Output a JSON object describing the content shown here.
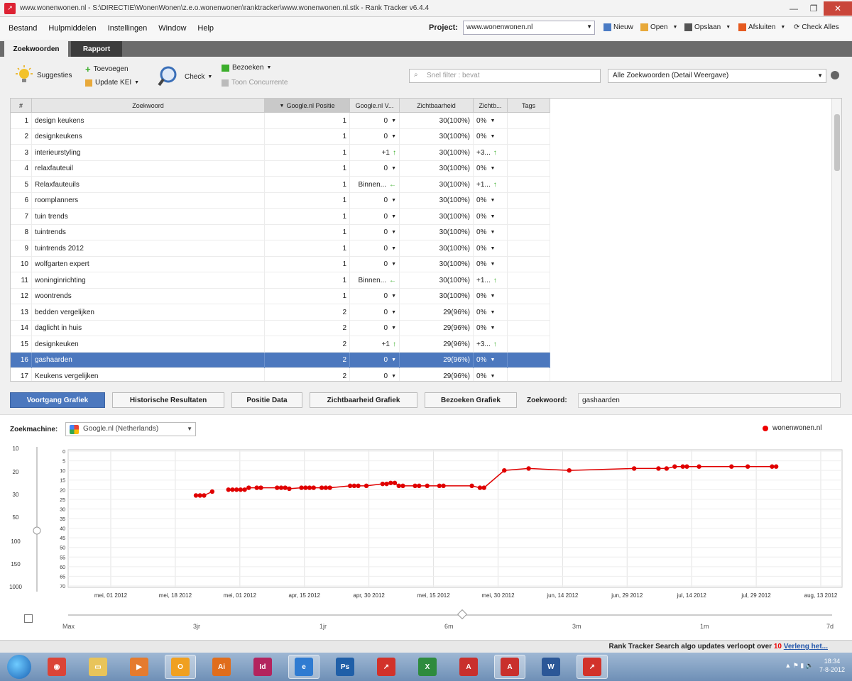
{
  "window": {
    "title": "www.wonenwonen.nl - S:\\DIRECTIE\\WonenWonen\\z.e.o.wonenwonen\\ranktracker\\www.wonenwonen.nl.stk - Rank Tracker v6.4.4"
  },
  "menu": [
    "Bestand",
    "Hulpmiddelen",
    "Instellingen",
    "Window",
    "Help"
  ],
  "project": {
    "label": "Project:",
    "value": "www.wonenwonen.nl"
  },
  "top_actions": {
    "new": "Nieuw",
    "open": "Open",
    "save": "Opslaan",
    "close": "Afsluiten",
    "check_all": "Check Alles"
  },
  "tabs": {
    "keywords": "Zoekwoorden",
    "report": "Rapport"
  },
  "toolbar": {
    "suggestions": "Suggesties",
    "add": "Toevoegen",
    "update_kei": "Update KEI",
    "check": "Check",
    "visits": "Bezoeken",
    "show_competitors": "Toon Concurrente",
    "filter_placeholder": "Snel filter : bevat",
    "view": "Alle Zoekwoorden (Detail Weergave)"
  },
  "grid": {
    "headers": [
      "#",
      "Zoekwoord",
      "Google.nl Positie",
      "Google.nl V...",
      "Zichtbaarheid",
      "Zichtb...",
      "Tags"
    ],
    "rows": [
      {
        "n": "1",
        "kw": "design keukens",
        "pos": "1",
        "ch": "0",
        "chi": "dd",
        "vis": "30(100%)",
        "vc": "0%",
        "vci": "dd"
      },
      {
        "n": "2",
        "kw": "designkeukens",
        "pos": "1",
        "ch": "0",
        "chi": "dd",
        "vis": "30(100%)",
        "vc": "0%",
        "vci": "dd"
      },
      {
        "n": "3",
        "kw": "interieurstyling",
        "pos": "1",
        "ch": "+1",
        "chi": "up",
        "vis": "30(100%)",
        "vc": "+3...",
        "vci": "up"
      },
      {
        "n": "4",
        "kw": "relaxfauteuil",
        "pos": "1",
        "ch": "0",
        "chi": "dd",
        "vis": "30(100%)",
        "vc": "0%",
        "vci": "dd"
      },
      {
        "n": "5",
        "kw": "Relaxfauteuils",
        "pos": "1",
        "ch": "Binnen...",
        "chi": "left",
        "vis": "30(100%)",
        "vc": "+1...",
        "vci": "up"
      },
      {
        "n": "6",
        "kw": "roomplanners",
        "pos": "1",
        "ch": "0",
        "chi": "dd",
        "vis": "30(100%)",
        "vc": "0%",
        "vci": "dd"
      },
      {
        "n": "7",
        "kw": "tuin trends",
        "pos": "1",
        "ch": "0",
        "chi": "dd",
        "vis": "30(100%)",
        "vc": "0%",
        "vci": "dd"
      },
      {
        "n": "8",
        "kw": "tuintrends",
        "pos": "1",
        "ch": "0",
        "chi": "dd",
        "vis": "30(100%)",
        "vc": "0%",
        "vci": "dd"
      },
      {
        "n": "9",
        "kw": "tuintrends 2012",
        "pos": "1",
        "ch": "0",
        "chi": "dd",
        "vis": "30(100%)",
        "vc": "0%",
        "vci": "dd"
      },
      {
        "n": "10",
        "kw": "wolfgarten expert",
        "pos": "1",
        "ch": "0",
        "chi": "dd",
        "vis": "30(100%)",
        "vc": "0%",
        "vci": "dd"
      },
      {
        "n": "11",
        "kw": "woninginrichting",
        "pos": "1",
        "ch": "Binnen...",
        "chi": "left",
        "vis": "30(100%)",
        "vc": "+1...",
        "vci": "up"
      },
      {
        "n": "12",
        "kw": "woontrends",
        "pos": "1",
        "ch": "0",
        "chi": "dd",
        "vis": "30(100%)",
        "vc": "0%",
        "vci": "dd"
      },
      {
        "n": "13",
        "kw": "bedden vergelijken",
        "pos": "2",
        "ch": "0",
        "chi": "dd",
        "vis": "29(96%)",
        "vc": "0%",
        "vci": "dd"
      },
      {
        "n": "14",
        "kw": "daglicht in huis",
        "pos": "2",
        "ch": "0",
        "chi": "dd",
        "vis": "29(96%)",
        "vc": "0%",
        "vci": "dd"
      },
      {
        "n": "15",
        "kw": "designkeuken",
        "pos": "2",
        "ch": "+1",
        "chi": "up",
        "vis": "29(96%)",
        "vc": "+3...",
        "vci": "up"
      },
      {
        "n": "16",
        "kw": "gashaarden",
        "pos": "2",
        "ch": "0",
        "chi": "dd",
        "vis": "29(96%)",
        "vc": "0%",
        "vci": "dd",
        "selected": true
      },
      {
        "n": "17",
        "kw": "Keukens vergelijken",
        "pos": "2",
        "ch": "0",
        "chi": "dd",
        "vis": "29(96%)",
        "vc": "0%",
        "vci": "dd"
      }
    ]
  },
  "panel_buttons": [
    "Voortgang Grafiek",
    "Historische Resultaten",
    "Positie Data",
    "Zichtbaarheid Grafiek",
    "Bezoeken Grafiek"
  ],
  "keyword_field": {
    "label": "Zoekwoord:",
    "value": "gashaarden"
  },
  "search_engine": {
    "label": "Zoekmachine:",
    "value": "Google.nl (Netherlands)"
  },
  "chart_data": {
    "type": "line",
    "series": [
      {
        "name": "wonenwonen.nl",
        "color": "#e00000",
        "x": [
          "2012-03-12",
          "2012-03-13",
          "2012-03-14",
          "2012-03-16",
          "2012-03-20",
          "2012-03-21",
          "2012-03-22",
          "2012-03-23",
          "2012-03-24",
          "2012-03-25",
          "2012-03-27",
          "2012-03-28",
          "2012-04-01",
          "2012-04-02",
          "2012-04-03",
          "2012-04-04",
          "2012-04-07",
          "2012-04-08",
          "2012-04-09",
          "2012-04-10",
          "2012-04-12",
          "2012-04-13",
          "2012-04-14",
          "2012-04-19",
          "2012-04-20",
          "2012-04-21",
          "2012-04-23",
          "2012-04-27",
          "2012-04-28",
          "2012-04-29",
          "2012-04-30",
          "2012-05-01",
          "2012-05-02",
          "2012-05-05",
          "2012-05-06",
          "2012-05-08",
          "2012-05-11",
          "2012-05-12",
          "2012-05-19",
          "2012-05-21",
          "2012-05-22",
          "2012-05-27",
          "2012-06-02",
          "2012-06-12",
          "2012-06-28",
          "2012-07-04",
          "2012-07-06",
          "2012-07-08",
          "2012-07-10",
          "2012-07-11",
          "2012-07-14",
          "2012-07-22",
          "2012-07-26",
          "2012-08-01",
          "2012-08-02"
        ],
        "values": [
          23,
          23,
          23,
          21,
          20,
          20,
          20,
          20,
          20,
          19,
          19,
          19,
          19,
          19,
          19,
          19.5,
          19,
          19,
          19,
          19,
          19,
          19,
          19,
          18,
          18,
          18,
          18,
          17,
          17,
          16.5,
          16.5,
          18,
          18,
          18,
          18,
          18,
          18,
          18,
          18,
          19,
          19,
          10,
          9,
          10,
          9,
          9,
          9,
          8,
          8,
          8,
          8,
          8,
          8,
          8,
          8
        ]
      }
    ],
    "y_ticks": [
      "10",
      "20",
      "30",
      "50",
      "100",
      "150",
      "1000"
    ],
    "y_scale_ticks": [
      "0",
      "5",
      "10",
      "15",
      "20",
      "25",
      "30",
      "35",
      "40",
      "45",
      "50",
      "55",
      "60",
      "65",
      "70"
    ],
    "x_ticks": [
      "mei, 01 2012",
      "mei, 18 2012",
      "mei, 01 2012",
      "apr, 15 2012",
      "apr, 30 2012",
      "mei, 15 2012",
      "mei, 30 2012",
      "jun, 14 2012",
      "jun, 29 2012",
      "jul, 14 2012",
      "jul, 29 2012",
      "aug, 13 2012"
    ],
    "ylim": [
      0,
      70
    ],
    "grid": true,
    "legend": "top-right"
  },
  "range_labels": [
    "Max",
    "3jr",
    "1jr",
    "6m",
    "3m",
    "1m",
    "7d"
  ],
  "status": {
    "text": "Rank Tracker Search algo updates verloopt over",
    "days": "10",
    "link": "Verleng het..."
  },
  "taskbar": {
    "apps": [
      "Chrome",
      "Explorer",
      "Media",
      "Outlook",
      "Illustrator",
      "InDesign",
      "Internet Explorer",
      "Photoshop",
      "Rank Tracker",
      "Excel",
      "Acrobat",
      "Reader",
      "Word",
      "Rank Tracker"
    ],
    "time": "18:34",
    "date": "7-8-2012"
  }
}
